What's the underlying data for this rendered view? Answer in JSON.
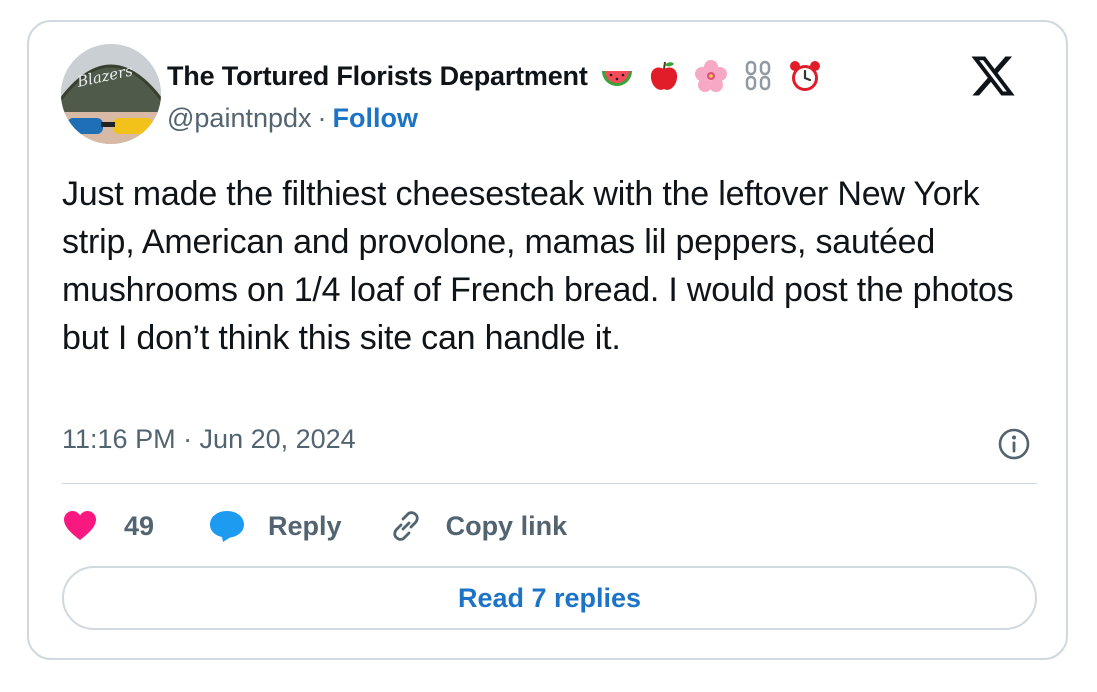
{
  "author": {
    "display_name": "The Tortured Florists Department",
    "handle": "@paintnpdx",
    "separator": "·",
    "follow_label": "Follow",
    "avatar_cap_text": "Blazers",
    "name_emojis": [
      "watermelon-emoji",
      "apple-emoji",
      "hibiscus-emoji",
      "chains-emoji",
      "alarm-clock-emoji"
    ]
  },
  "tweet": {
    "text": "Just made the filthiest cheesesteak with the leftover New York strip, American and provolone, mamas lil peppers, sautéed mushrooms on 1/4 loaf of French bread. I would post the photos but I don’t think this site can handle it.",
    "timestamp": "11:16 PM · Jun 20, 2024"
  },
  "actions": {
    "like_count": "49",
    "reply_label": "Reply",
    "copy_link_label": "Copy link"
  },
  "read_replies_label": "Read 7 replies",
  "colors": {
    "link_blue": "#1d74c6",
    "like_pink": "#f91880",
    "reply_blue": "#1d9bf0",
    "muted_gray": "#536471",
    "border": "#cfd9de"
  }
}
